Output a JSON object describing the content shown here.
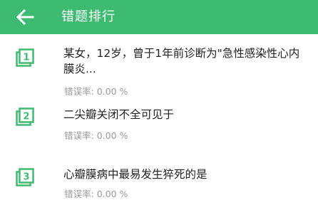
{
  "appbar": {
    "title": "错题排行",
    "back_icon": "arrow-left-icon",
    "color": "#3dbb71"
  },
  "accent_color": "#3dbb71",
  "items": [
    {
      "rank": "1",
      "question": "某女，12岁，曾于1年前诊断为\"急性感染性心内膜炎...",
      "rate_label": "错误率:",
      "rate_value": "0.00 %"
    },
    {
      "rank": "2",
      "question": "二尖瓣关闭不全可见于",
      "rate_label": "错误率:",
      "rate_value": "0.00 %"
    },
    {
      "rank": "3",
      "question": "心瓣膜病中最易发生猝死的是",
      "rate_label": "错误率:",
      "rate_value": "0.00 %"
    }
  ]
}
